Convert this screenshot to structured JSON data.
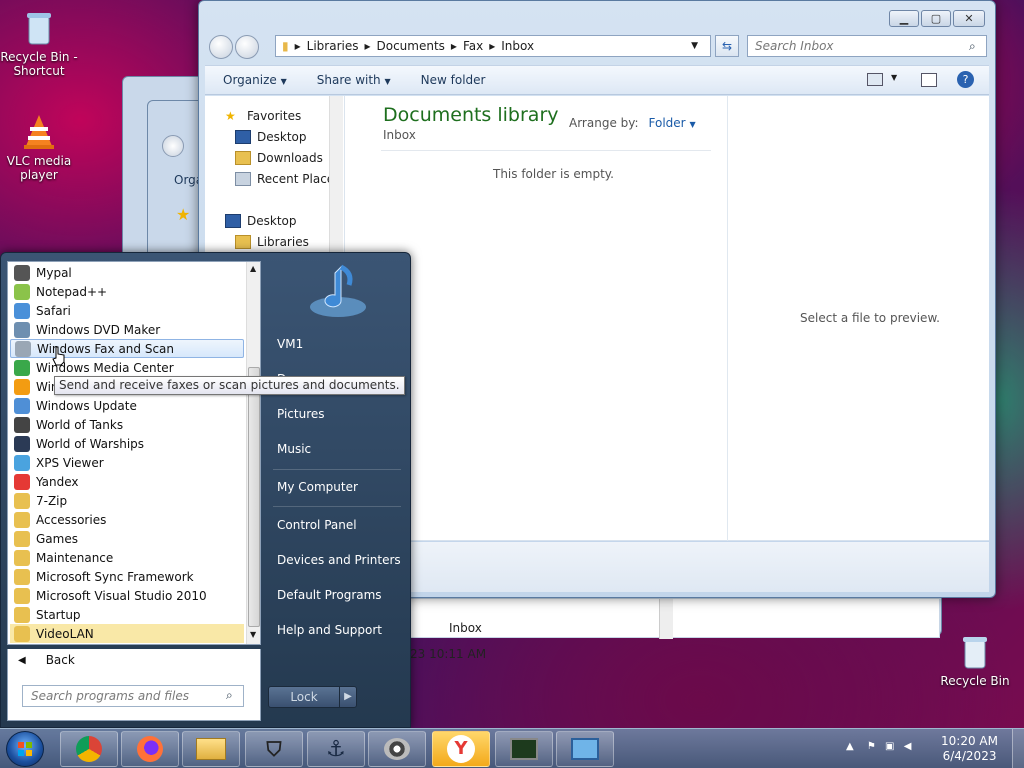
{
  "desktop": {
    "icons": [
      {
        "label": "Recycle Bin - Shortcut"
      },
      {
        "label": "VLC media player"
      },
      {
        "label": "Recycle Bin"
      }
    ]
  },
  "explorer": {
    "breadcrumb": [
      "Libraries",
      "Documents",
      "Fax",
      "Inbox"
    ],
    "search_placeholder": "Search Inbox",
    "toolbar": {
      "organize": "Organize",
      "share_with": "Share with",
      "new_folder": "New folder"
    },
    "nav": {
      "favorites": "Favorites",
      "desktop": "Desktop",
      "downloads": "Downloads",
      "recent_places": "Recent Places",
      "desktop2": "Desktop",
      "libraries": "Libraries"
    },
    "library_title": "Documents library",
    "library_sub": "Inbox",
    "arrange_label": "Arrange by:",
    "arrange_value": "Folder",
    "empty_text": "This folder is empty.",
    "preview_text": "Select a file to preview."
  },
  "bg_window": {
    "organize_partial": "Orga",
    "inbox_label": "Inbox",
    "date_partial": "23 10:11 AM"
  },
  "start_menu": {
    "programs": [
      {
        "label": "Mypal",
        "color": "#555555"
      },
      {
        "label": "Notepad++",
        "color": "#8bc34a"
      },
      {
        "label": "Safari",
        "color": "#4a90d9"
      },
      {
        "label": "Windows DVD Maker",
        "color": "#6e8fb0"
      },
      {
        "label": "Windows Fax and Scan",
        "color": "#9aa7b5"
      },
      {
        "label": "Windows Media Center",
        "color": "#3aa84a"
      },
      {
        "label": "Win",
        "color": "#f39c12"
      },
      {
        "label": "Windows Update",
        "color": "#4f8fd6"
      },
      {
        "label": "World of Tanks",
        "color": "#444444"
      },
      {
        "label": "World of Warships",
        "color": "#2b3a55"
      },
      {
        "label": "XPS Viewer",
        "color": "#4aa3df"
      },
      {
        "label": "Yandex",
        "color": "#e53935"
      },
      {
        "label": "7-Zip",
        "color": "#e8c050"
      },
      {
        "label": "Accessories",
        "color": "#e8c050"
      },
      {
        "label": "Games",
        "color": "#e8c050"
      },
      {
        "label": "Maintenance",
        "color": "#e8c050"
      },
      {
        "label": "Microsoft Sync Framework",
        "color": "#e8c050"
      },
      {
        "label": "Microsoft Visual Studio 2010",
        "color": "#e8c050"
      },
      {
        "label": "Startup",
        "color": "#e8c050"
      },
      {
        "label": "VideoLAN",
        "color": "#e8c050"
      }
    ],
    "tooltip": "Send and receive faxes or scan pictures and documents.",
    "back": "Back",
    "search_placeholder": "Search programs and files",
    "right_items": {
      "user": "VM1",
      "documents_partial": "D",
      "pictures": "Pictures",
      "music": "Music",
      "my_computer": "My Computer",
      "control_panel": "Control Panel",
      "devices_printers": "Devices and Printers",
      "default_programs": "Default Programs",
      "help_support": "Help and Support"
    },
    "lock": "Lock"
  },
  "taskbar": {
    "time": "10:20 AM",
    "date": "6/4/2023"
  }
}
